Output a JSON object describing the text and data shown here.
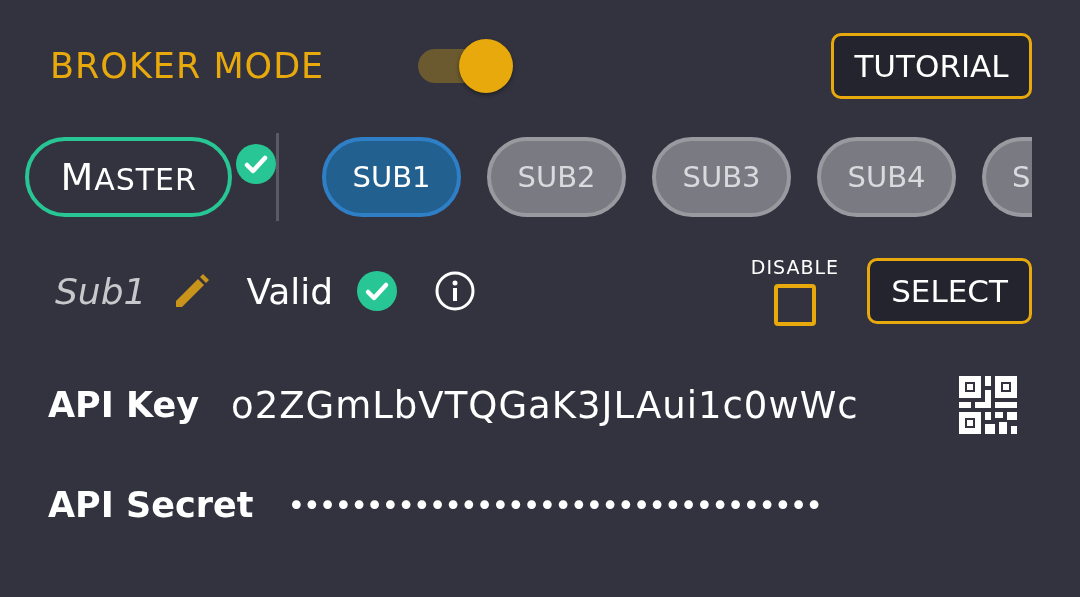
{
  "broker_mode": {
    "label": "BROKER MODE",
    "on": true
  },
  "tutorial_button": "TUTORIAL",
  "master": {
    "label": "MASTER",
    "selected": false,
    "verified": true
  },
  "accounts": [
    {
      "label": "SUB1",
      "selected": true
    },
    {
      "label": "SUB2",
      "selected": false
    },
    {
      "label": "SUB3",
      "selected": false
    },
    {
      "label": "SUB4",
      "selected": false
    },
    {
      "label": "S",
      "selected": false
    }
  ],
  "account": {
    "name": "Sub1",
    "status": "Valid",
    "valid": true
  },
  "disable": {
    "label": "DISABLE",
    "checked": false
  },
  "select_button": "SELECT",
  "api_key": {
    "label": "API Key",
    "value": "o2ZGmLbVTQGaK3JLAui1c0wWc"
  },
  "api_secret": {
    "label": "API Secret",
    "value": "••••••••••••••••••••••••••••••••••"
  }
}
